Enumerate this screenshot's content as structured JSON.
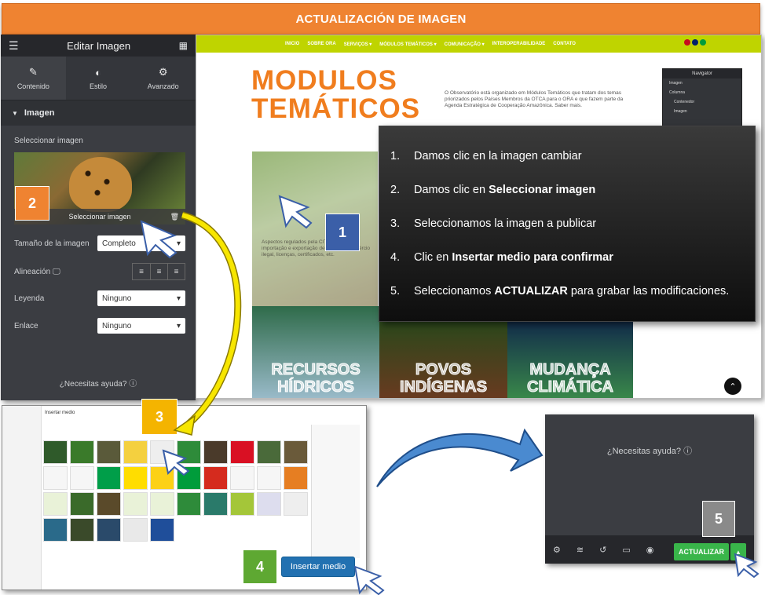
{
  "banner": {
    "title": "ACTUALIZACIÓN DE IMAGEN"
  },
  "panel": {
    "title": "Editar Imagen",
    "tabs": [
      {
        "label": "Contenido",
        "icon": "pencil-icon"
      },
      {
        "label": "Estilo",
        "icon": "half-circle-icon"
      },
      {
        "label": "Avanzado",
        "icon": "gear-icon"
      }
    ],
    "section_title": "Imagen",
    "select_image_label": "Seleccionar imagen",
    "select_image_button": "Seleccionar imagen",
    "size_label": "Tamaño de la imagen",
    "size_value": "Completo",
    "align_label": "Alineación",
    "caption_label": "Leyenda",
    "caption_value": "Ninguno",
    "link_label": "Enlace",
    "link_value": "Ninguno",
    "help": "¿Necesitas ayuda?"
  },
  "site": {
    "nav": [
      "INICIO",
      "SOBRE ORA",
      "SERVIÇOS ▾",
      "MÓDULOS TEMÁTICOS ▾",
      "COMUNICAÇÃO ▾",
      "INTEROPERABILIDADE",
      "CONTATO"
    ],
    "title_line1": "MODULOS",
    "title_line2": "TEMÁTICOS",
    "description": "O Observatório está organizado em Módulos Temáticos que tratam dos temas priorizados pelos Países Membros da OTCA para o ORA e que fazem parte da Agenda Estratégica de Cooperação Amazônica. Saber mais.",
    "navigator": {
      "title": "Navigator",
      "items": [
        "Imagen",
        "Columna",
        "Contenedor",
        "Imagen"
      ]
    },
    "cites_text": "Aspectos regulados pela CITES tais como importação e exportação de espécies, comércio ilegal, licenças, certificados, etc.",
    "tiles": [
      {
        "label": "RECURSOS HÍDRICOS",
        "color": "#3d6b8a"
      },
      {
        "label": "POVOS INDÍGENAS",
        "color": "#5a3a2a"
      },
      {
        "label": "MUDANÇA CLIMÁTICA",
        "color": "#2a5a9a"
      }
    ]
  },
  "steps": [
    {
      "num": "1.",
      "text": "Damos clic en la imagen cambiar",
      "bold": "",
      "after": ""
    },
    {
      "num": "2.",
      "text": "Damos clic en ",
      "bold": "Seleccionar imagen",
      "after": ""
    },
    {
      "num": "3.",
      "text": "Seleccionamos la imagen a publicar",
      "bold": "",
      "after": ""
    },
    {
      "num": "4.",
      "text": "Clic en ",
      "bold": "Insertar medio para confirmar",
      "after": ""
    },
    {
      "num": "5.",
      "text": "Seleccionamos ",
      "bold": "ACTUALIZAR",
      "after": " para grabar las modificaciones."
    }
  ],
  "badges": {
    "b1": "1",
    "b2": "2",
    "b3": "3",
    "b4": "4",
    "b5": "5"
  },
  "colors": {
    "badge1": "#3b5fa8",
    "badge2": "#ef8331",
    "badge3": "#f4b400",
    "badge4": "#5ea832",
    "badge5": "#8a8a8a"
  },
  "media": {
    "title": "Insertar medio",
    "insert_button": "Insertar medio"
  },
  "bottom": {
    "help": "¿Necesitas ayuda?",
    "update_button": "ACTUALIZAR"
  }
}
